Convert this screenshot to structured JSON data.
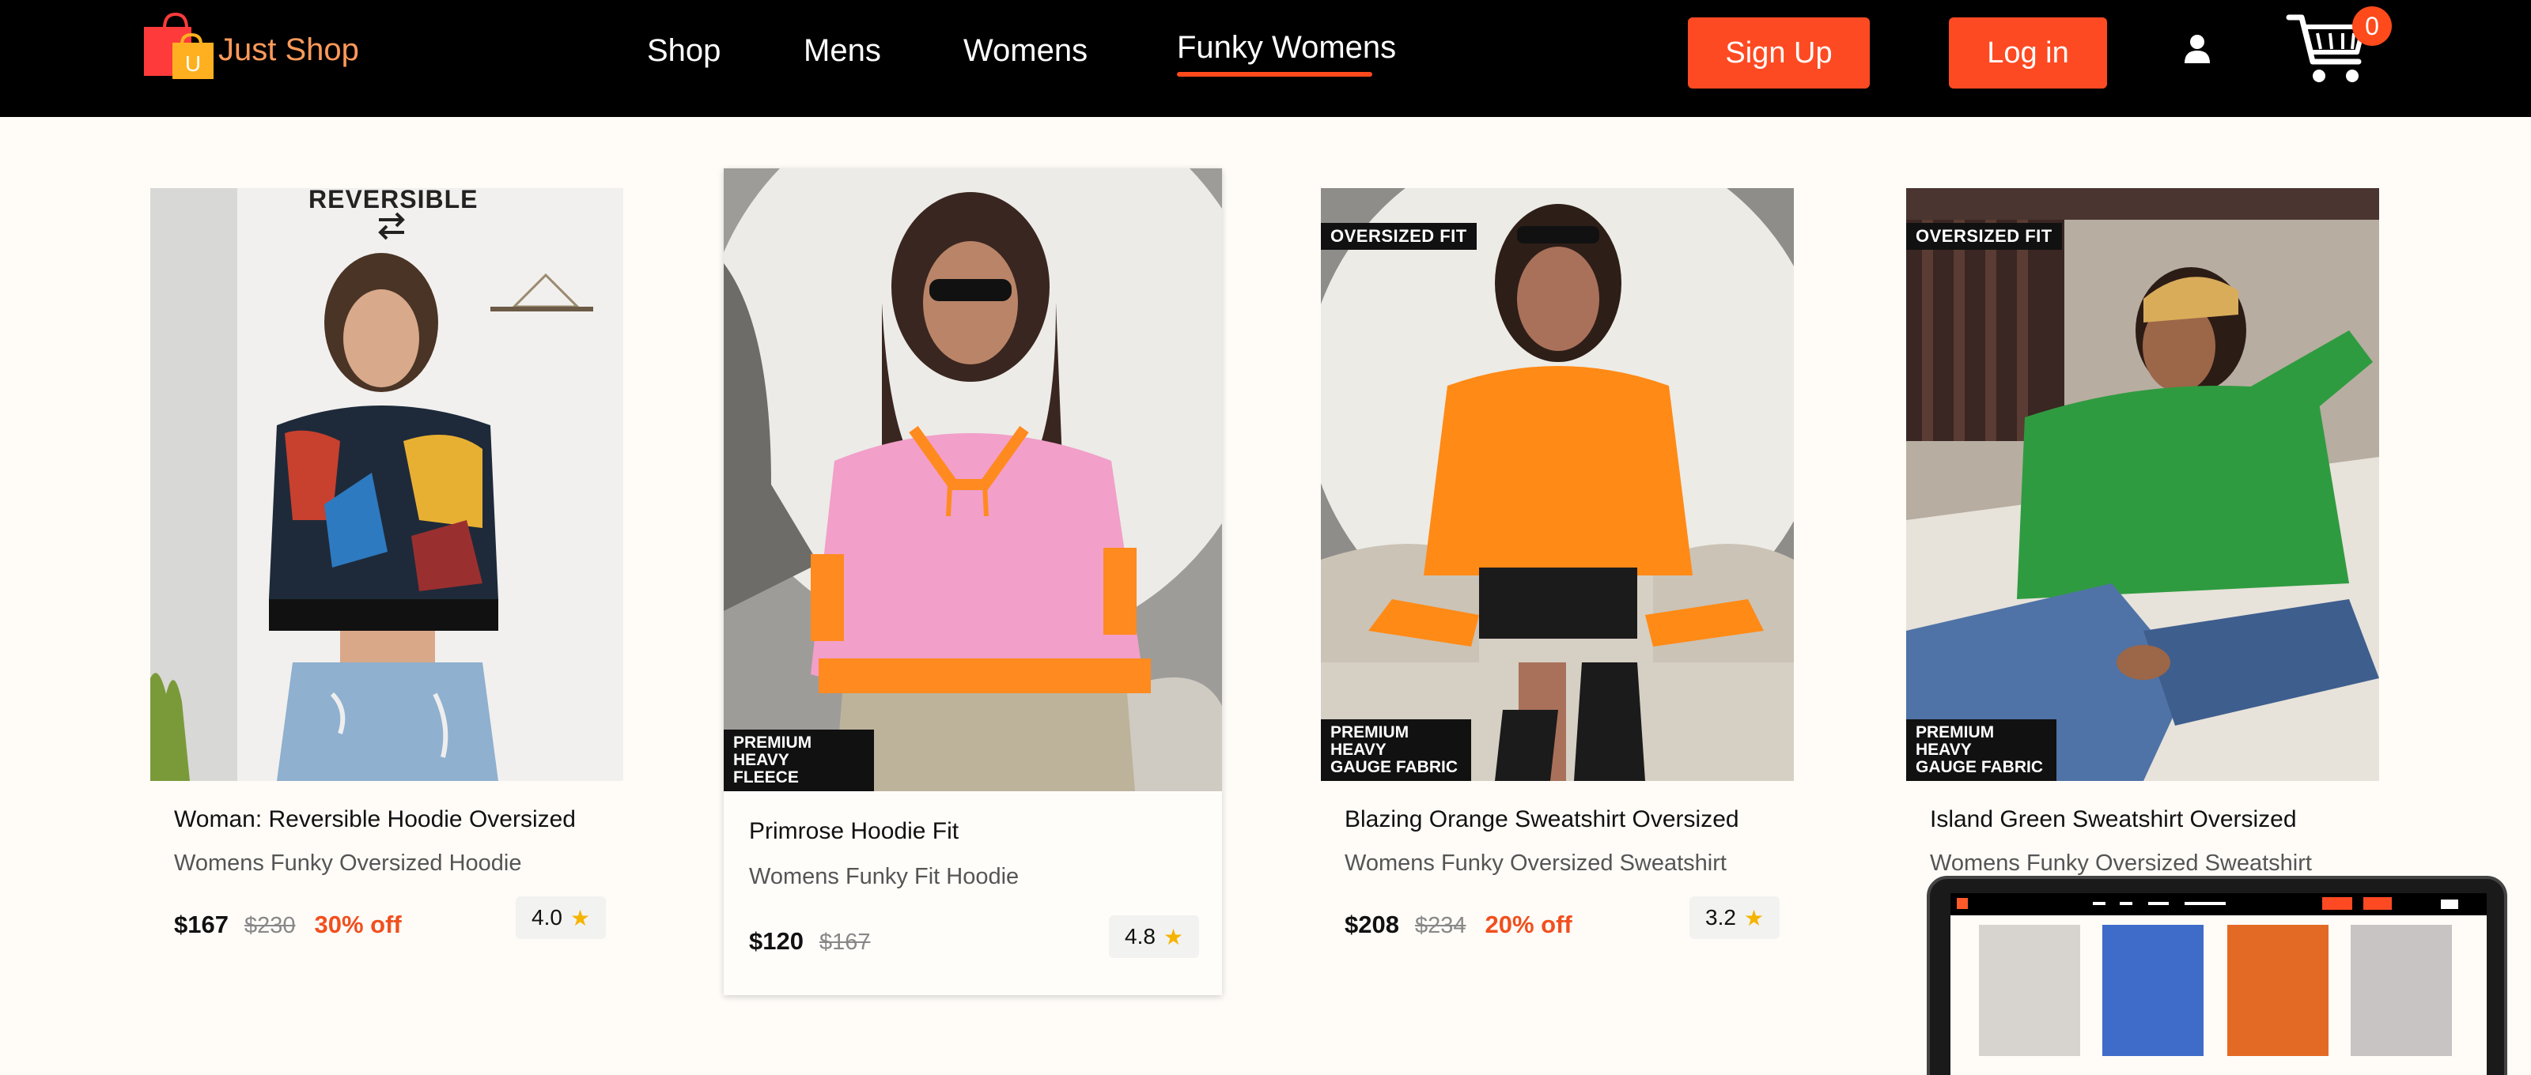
{
  "brand": {
    "name": "Just Shop",
    "logo_letter": "U"
  },
  "nav": {
    "links": [
      "Shop",
      "Mens",
      "Womens",
      "Funky Womens"
    ],
    "active": "Funky Womens",
    "signup": "Sign Up",
    "login": "Log in",
    "cart_count": "0"
  },
  "products": [
    {
      "name": "Woman: Reversible Hoodie Oversized",
      "category": "Womens Funky Oversized Hoodie",
      "price": "$167",
      "old_price": "$230",
      "discount": "30% off",
      "rating": "4.0",
      "image_text": "REVERSIBLE"
    },
    {
      "name": "Primrose Hoodie Fit",
      "category": "Womens Funky Fit Hoodie",
      "price": "$120",
      "old_price": "$167",
      "rating": "4.8",
      "tag_bottom": [
        "PREMIUM HEAVY",
        "FLEECE"
      ]
    },
    {
      "name": "Blazing Orange Sweatshirt Oversized",
      "category": "Womens Funky Oversized Sweatshirt",
      "price": "$208",
      "old_price": "$234",
      "discount": "20% off",
      "rating": "3.2",
      "tag_top": "OVERSIZED FIT",
      "tag_bottom": [
        "PREMIUM HEAVY",
        "GAUGE FABRIC"
      ]
    },
    {
      "name": "Island Green Sweatshirt Oversized",
      "category": "Womens Funky Oversized Sweatshirt",
      "tag_top": "OVERSIZED FIT",
      "tag_bottom": [
        "PREMIUM HEAVY",
        "GAUGE FABRIC"
      ]
    }
  ],
  "colors": {
    "accent": "#fd4a22",
    "nav_bg": "#000000",
    "page_bg": "#fffcf8",
    "star": "#f5b400"
  }
}
